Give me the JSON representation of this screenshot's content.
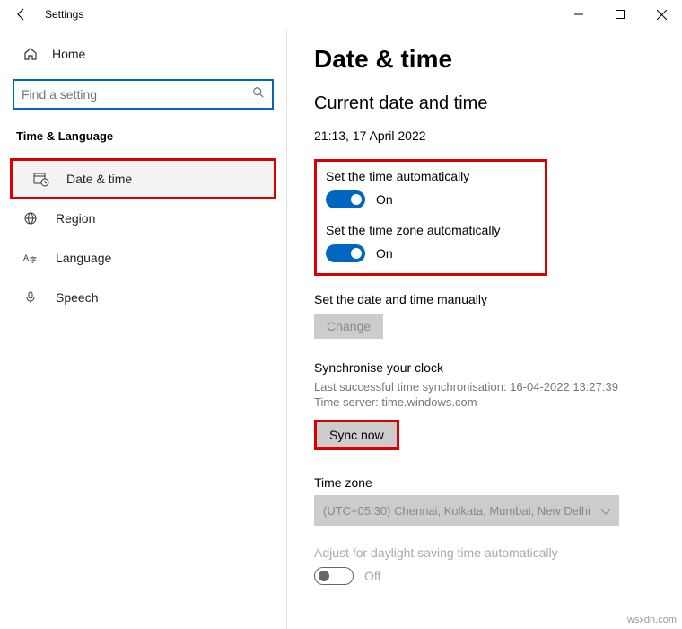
{
  "window": {
    "title": "Settings"
  },
  "sidebar": {
    "home": "Home",
    "search_placeholder": "Find a setting",
    "category": "Time & Language",
    "items": [
      {
        "label": "Date & time"
      },
      {
        "label": "Region"
      },
      {
        "label": "Language"
      },
      {
        "label": "Speech"
      }
    ]
  },
  "content": {
    "heading": "Date & time",
    "subheading": "Current date and time",
    "current_datetime": "21:13, 17 April 2022",
    "auto_time": {
      "label": "Set the time automatically",
      "state": "On"
    },
    "auto_tz": {
      "label": "Set the time zone automatically",
      "state": "On"
    },
    "manual": {
      "label": "Set the date and time manually",
      "button": "Change"
    },
    "sync": {
      "heading": "Synchronise your clock",
      "last": "Last successful time synchronisation: 16-04-2022 13:27:39",
      "server": "Time server: time.windows.com",
      "button": "Sync now"
    },
    "timezone": {
      "heading": "Time zone",
      "value": "(UTC+05:30) Chennai, Kolkata, Mumbai, New Delhi"
    },
    "dst": {
      "label": "Adjust for daylight saving time automatically",
      "state": "Off"
    }
  },
  "watermark": "wsxdn.com"
}
